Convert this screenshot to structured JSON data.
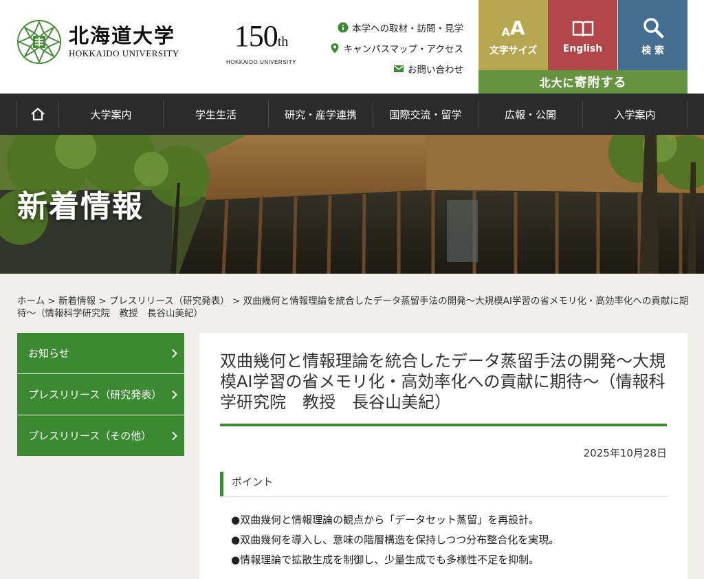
{
  "header": {
    "logo": {
      "ja": "北海道大学",
      "en": "HOKKAIDO UNIVERSITY"
    },
    "anniversary": {
      "number": "150",
      "suffix": "th",
      "sub": "HOKKAIDO UNIVERSITY"
    },
    "utility_links": [
      {
        "label": "本学への取材・訪問・見学",
        "icon": "info-icon"
      },
      {
        "label": "キャンパスマップ・アクセス",
        "icon": "map-pin-icon"
      },
      {
        "label": "お問い合わせ",
        "icon": "mail-icon"
      }
    ],
    "tools": [
      {
        "label": "文字サイズ",
        "icon": "font-size-icon",
        "color": "#b6a650"
      },
      {
        "label": "English",
        "icon": "book-icon",
        "color": "#b0464a"
      },
      {
        "label": "検 索",
        "icon": "search-icon",
        "color": "#436d91"
      }
    ],
    "donate": {
      "prefix": "北大に",
      "main": "寄附する",
      "color": "#66933f"
    }
  },
  "nav": {
    "home_icon": "home-icon",
    "items": [
      "大学案内",
      "学生生活",
      "研究・産学連携",
      "国際交流・留学",
      "広報・公開",
      "入学案内"
    ]
  },
  "hero": {
    "title": "新着情報"
  },
  "breadcrumb": {
    "items": [
      "ホーム",
      "新着情報",
      "プレスリリース（研究発表）"
    ],
    "separator": ">",
    "current": "双曲幾何と情報理論を統合したデータ蒸留手法の開発〜大規模AI学習の省メモリ化・高効率化への貢献に期待〜（情報科学研究院　教授　長谷山美紀）"
  },
  "sidebar": {
    "items": [
      "お知らせ",
      "プレスリリース（研究発表）",
      "プレスリリース（その他）"
    ],
    "color": "#3b8a31"
  },
  "article": {
    "title": "双曲幾何と情報理論を統合したデータ蒸留手法の開発〜大規模AI学習の省メモリ化・高効率化への貢献に期待〜（情報科学研究院　教授　長谷山美紀）",
    "date": "2025年10月28日",
    "section_heading": "ポイント",
    "points": [
      "●双曲幾何と情報理論の観点から「データセット蒸留」を再設計。",
      "●双曲幾何を導入し、意味の階層構造を保持しつつ分布整合化を実現。",
      "●情報理論で拡散生成を制御し、少量生成でも多様性不足を抑制。"
    ]
  }
}
